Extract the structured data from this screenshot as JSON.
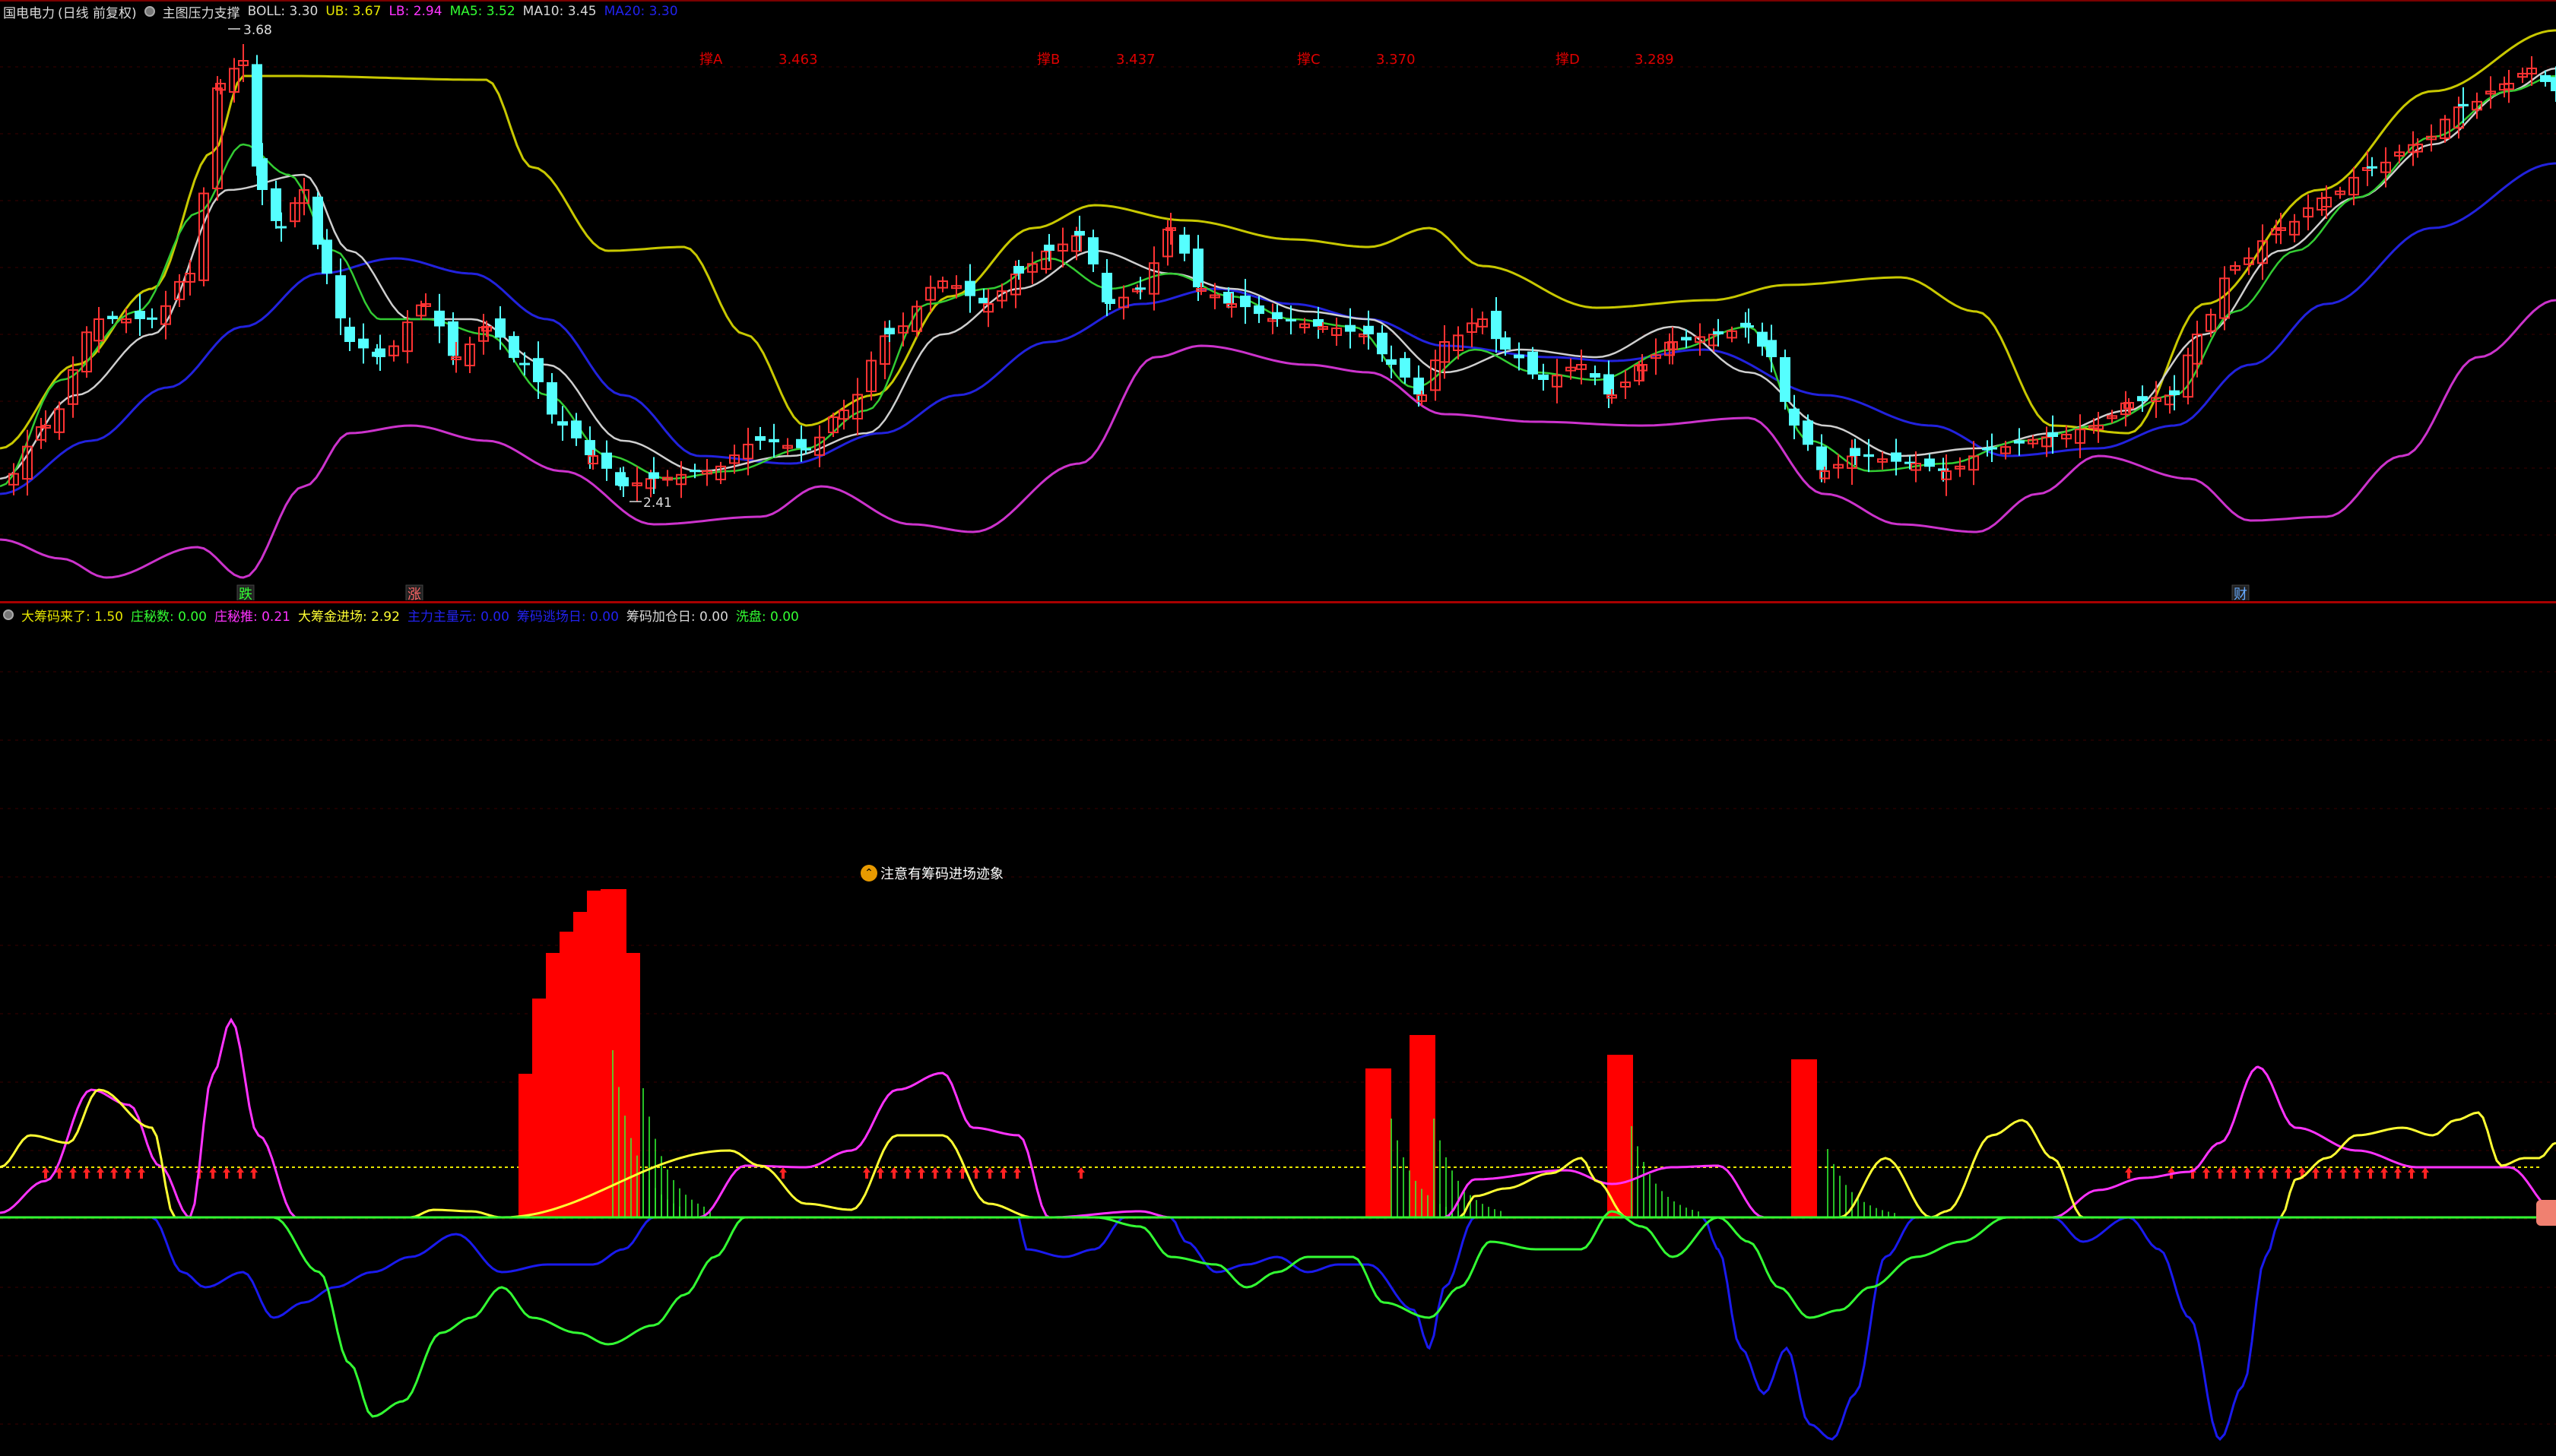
{
  "upper": {
    "stock_name": "国电电力",
    "period_label": "(日线 前复权)",
    "indicator_name": "主图压力支撑",
    "legend": [
      {
        "label": "BOLL",
        "value": "3.30",
        "color": "#d8d8d8"
      },
      {
        "label": "UB",
        "value": "3.67",
        "color": "#e6e600"
      },
      {
        "label": "LB",
        "value": "2.94",
        "color": "#ff33ff"
      },
      {
        "label": "MA5",
        "value": "3.52",
        "color": "#33ff33"
      },
      {
        "label": "MA10",
        "value": "3.45",
        "color": "#d8d8d8"
      },
      {
        "label": "MA20",
        "value": "3.30",
        "color": "#2222ee"
      }
    ],
    "high_label": "3.68",
    "low_label": "2.41",
    "resistance_labels": [
      {
        "name": "撑A",
        "value": "3.463"
      },
      {
        "name": "撑B",
        "value": "3.437"
      },
      {
        "name": "撑C",
        "value": "3.370"
      },
      {
        "name": "撑D",
        "value": "3.289"
      }
    ],
    "bottom_marks": [
      {
        "text": "跌",
        "color": "#33ff33"
      },
      {
        "text": "涨",
        "color": "#ff6666"
      },
      {
        "text": "财",
        "color": "#66aaff"
      }
    ]
  },
  "lower": {
    "indicator_name": "大筹码来了",
    "legend": [
      {
        "label": "大筹码来了",
        "value": "1.50",
        "color": "#e6e600"
      },
      {
        "label": "庄秘数",
        "value": "0.00",
        "color": "#33ff33"
      },
      {
        "label": "庄秘推",
        "value": "0.21",
        "color": "#ff33ff"
      },
      {
        "label": "大筹金进场",
        "value": "2.92",
        "color": "#ffff33"
      },
      {
        "label": "主力主量元",
        "value": "0.00",
        "color": "#2222ee"
      },
      {
        "label": "筹码逃场日",
        "value": "0.00",
        "color": "#2222ee"
      },
      {
        "label": "筹码加仓日",
        "value": "0.00",
        "color": "#d8d8d8"
      },
      {
        "label": "洗盘",
        "value": "0.00",
        "color": "#33ff33"
      }
    ],
    "annotation": "注意有筹码进场迹象"
  },
  "colors": {
    "up_candle": "#ff3333",
    "down_candle": "#55ffff",
    "boll_mid": "#d8d8d8",
    "boll_upper": "#c8c800",
    "boll_lower": "#cc33cc",
    "ma5": "#33cc33",
    "ma10": "#cfcfcf",
    "ma20": "#2222dd",
    "bars": "#ff0000"
  }
}
